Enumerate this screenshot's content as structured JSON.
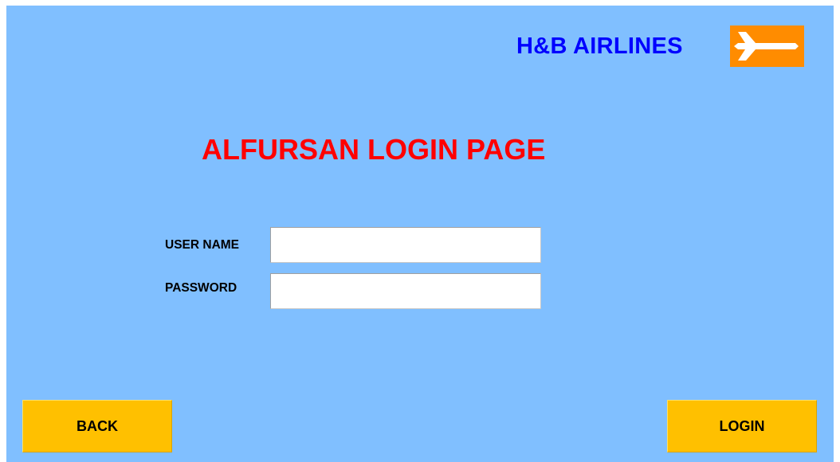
{
  "header": {
    "brand_name": "H&B AIRLINES",
    "brand_logo_icon": "airplane-icon",
    "brand_color": "#0000ff",
    "logo_background": "#ff8c00"
  },
  "main": {
    "title": "ALFURSAN LOGIN PAGE",
    "title_color": "#ff0000",
    "background_color": "#80bfff"
  },
  "form": {
    "username_label": "USER NAME",
    "username_value": "",
    "password_label": "PASSWORD",
    "password_value": ""
  },
  "footer": {
    "back_label": "BACK",
    "login_label": "LOGIN",
    "button_color": "#ffc000"
  }
}
